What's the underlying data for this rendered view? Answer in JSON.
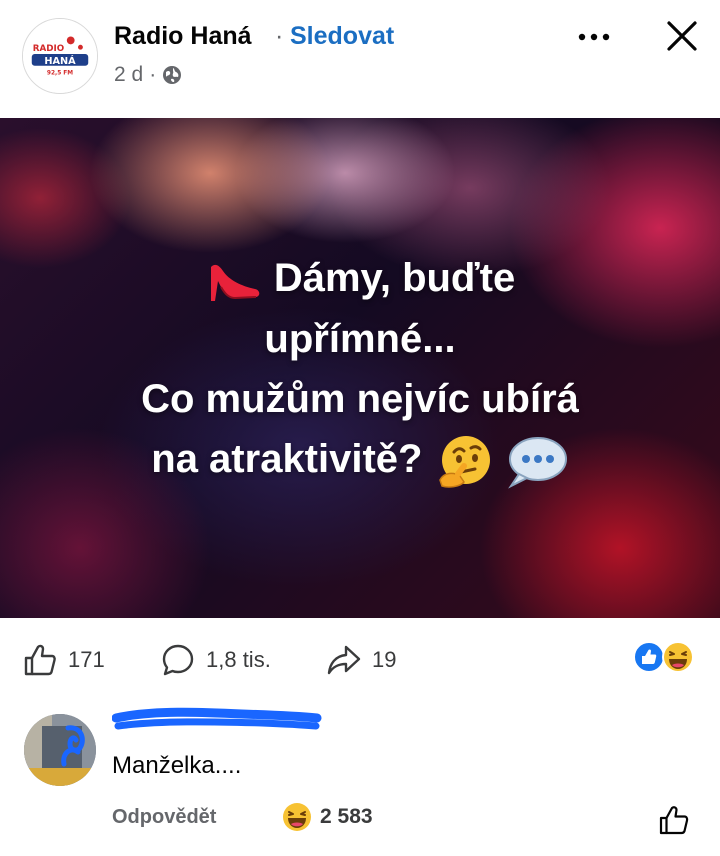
{
  "header": {
    "page_name": "Radio Haná",
    "separator": "·",
    "follow_label": "Sledovat",
    "time": "2 d",
    "time_separator": "·",
    "logo_text": {
      "brand1": "RADIO",
      "brand2": "HANÁ",
      "freq": "92,5 FM"
    },
    "icons": [
      "globe-icon",
      "more-icon",
      "close-icon"
    ]
  },
  "post": {
    "lines": [
      "Dámy, buďte",
      "upřímné...",
      "Co mužům nejvíc ubírá",
      "na atraktivitě?"
    ],
    "icons": [
      "high-heel-emoji",
      "thinking-face-emoji",
      "speech-bubble-emoji"
    ]
  },
  "stats": {
    "likes": "171",
    "comments": "1,8 tis.",
    "shares": "19",
    "reactions": [
      "like-reaction-icon",
      "haha-reaction-icon"
    ]
  },
  "comment": {
    "author_redacted": true,
    "text": "Manželka....",
    "reply_label": "Odpovědět",
    "reaction_count": "2 583",
    "reaction_icon": "haha-reaction-icon"
  },
  "colors": {
    "accent": "#1b6ec2",
    "text": "#050505",
    "muted": "#65676b",
    "logo_red": "#d32a2a",
    "logo_navy": "#1e3f8a",
    "redaction": "#1a66ff"
  }
}
